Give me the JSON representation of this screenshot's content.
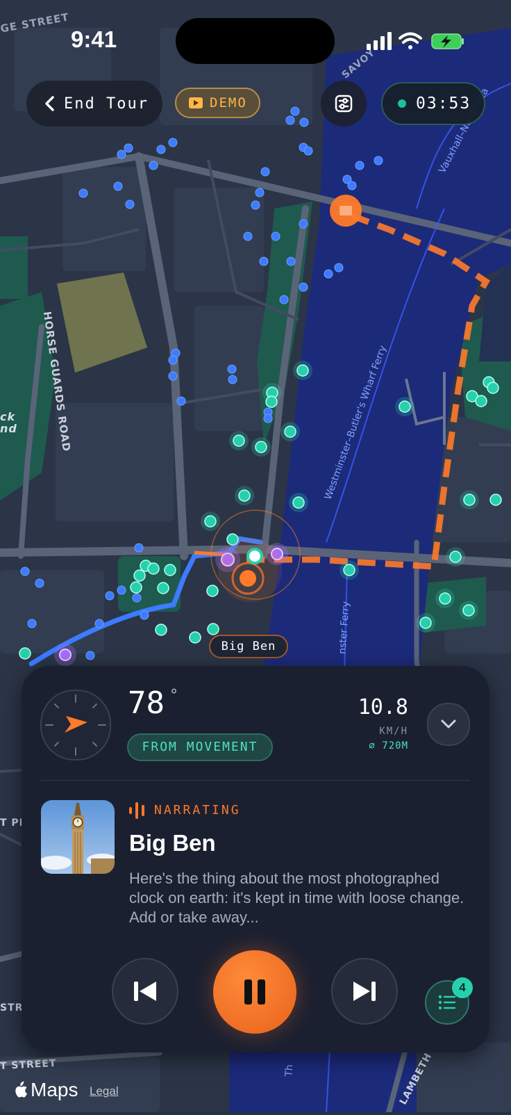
{
  "status_bar": {
    "time": "9:41",
    "icons": [
      "signal-icon",
      "wifi-icon",
      "battery-charging-icon"
    ]
  },
  "top_bar": {
    "end_tour_label": "End Tour",
    "demo_label": "DEMO",
    "timer": "03:53",
    "icons": [
      "chevron-left-icon",
      "play-badge-icon",
      "filter-sliders-icon"
    ]
  },
  "map": {
    "street_labels": [
      "GE STREET",
      "SAVOY",
      "HORSE GUARDS ROAD",
      "ck",
      "nd",
      "T PE",
      "STR",
      "T STREET",
      "LAMBETH"
    ],
    "water_labels": [
      "Vauxhall–North Sea",
      "Westminster–Butler's Wharf Ferry",
      "nster Ferry",
      "Th"
    ],
    "poi_tag": "Big Ben"
  },
  "panel": {
    "heading_value": "78",
    "heading_unit": "°",
    "heading_source": "FROM MOVEMENT",
    "speed": "10.8",
    "speed_unit": "KM/H",
    "distance": "⌀ 720M",
    "narration_status": "NARRATING",
    "poi_title": "Big Ben",
    "poi_description": "Here's the thing about the most photographed clock on earth: it's kept in time with loose change. Add or take away...",
    "queue_count": "4"
  },
  "footer": {
    "maps_brand": "Maps",
    "legal_link": "Legal"
  },
  "colors": {
    "accent_orange": "#ff7a2a",
    "accent_teal": "#27d0ac",
    "route_blue": "#3d7bff",
    "poi_purple": "#a86cff",
    "water": "#1c2a7a"
  }
}
